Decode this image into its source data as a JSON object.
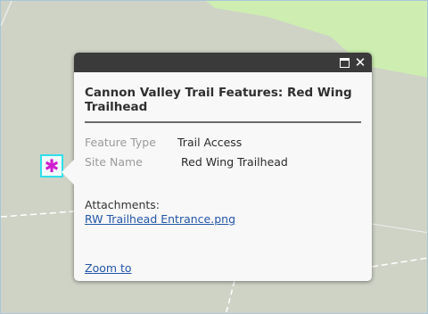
{
  "popup": {
    "title": "Cannon Valley Trail Features: Red Wing Trailhead",
    "header_icons": [
      "maximize-icon",
      "close-icon"
    ],
    "close_glyph": "✕",
    "fields": [
      {
        "label": "Feature Type",
        "value": "Trail Access"
      },
      {
        "label": "Site Name",
        "value": "Red Wing Trailhead"
      }
    ],
    "attachments_label": "Attachments:",
    "attachment_link": "RW Trailhead Entrance.png",
    "zoom_link": "Zoom to"
  },
  "map": {
    "marker_icon": "trail-access-marker-icon",
    "marker_glyph": "✱",
    "colors": {
      "land": "#cfd3c6",
      "park": "#cdeeb0",
      "marker": "#d01ecf",
      "selection_outline": "#2fe0ec",
      "popup_header": "#3a3a3a",
      "link": "#2356a8"
    }
  }
}
